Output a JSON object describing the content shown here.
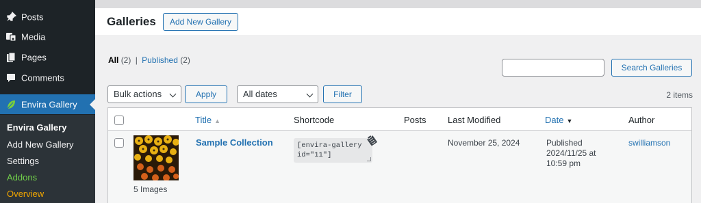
{
  "sidebar": {
    "items": [
      {
        "label": "Posts",
        "icon": "pin-icon"
      },
      {
        "label": "Media",
        "icon": "media-icon"
      },
      {
        "label": "Pages",
        "icon": "pages-icon"
      },
      {
        "label": "Comments",
        "icon": "comment-icon"
      }
    ],
    "active": {
      "label": "Envira Gallery",
      "icon": "leaf-icon"
    },
    "submenu": [
      "Envira Gallery",
      "Add New Gallery",
      "Settings",
      "Addons",
      "Overview"
    ],
    "colors": {
      "addons": "#72d24a",
      "overview": "#f0a500",
      "active_bg": "#2271b1"
    }
  },
  "header": {
    "title": "Galleries",
    "add_new_label": "Add New Gallery"
  },
  "views": {
    "all_label": "All",
    "all_count": "(2)",
    "separator": "|",
    "published_label": "Published",
    "published_count": "(2)"
  },
  "search": {
    "placeholder": "",
    "button_label": "Search Galleries"
  },
  "bulk": {
    "selected": "Bulk actions",
    "apply_label": "Apply"
  },
  "dates": {
    "selected": "All dates",
    "filter_label": "Filter"
  },
  "items_count": "2 items",
  "table": {
    "columns": {
      "title": "Title",
      "shortcode": "Shortcode",
      "posts": "Posts",
      "last_modified": "Last Modified",
      "date": "Date",
      "author": "Author"
    },
    "rows": [
      {
        "title": "Sample Collection",
        "image_count": "5 Images",
        "shortcode_line1": "[envira-gallery",
        "shortcode_line2": "id=\"11\"]",
        "posts": "",
        "last_modified": "November 25, 2024",
        "date_status": "Published",
        "date_line1": "2024/11/25 at",
        "date_line2": "10:59 pm",
        "author": "swilliamson"
      }
    ]
  }
}
